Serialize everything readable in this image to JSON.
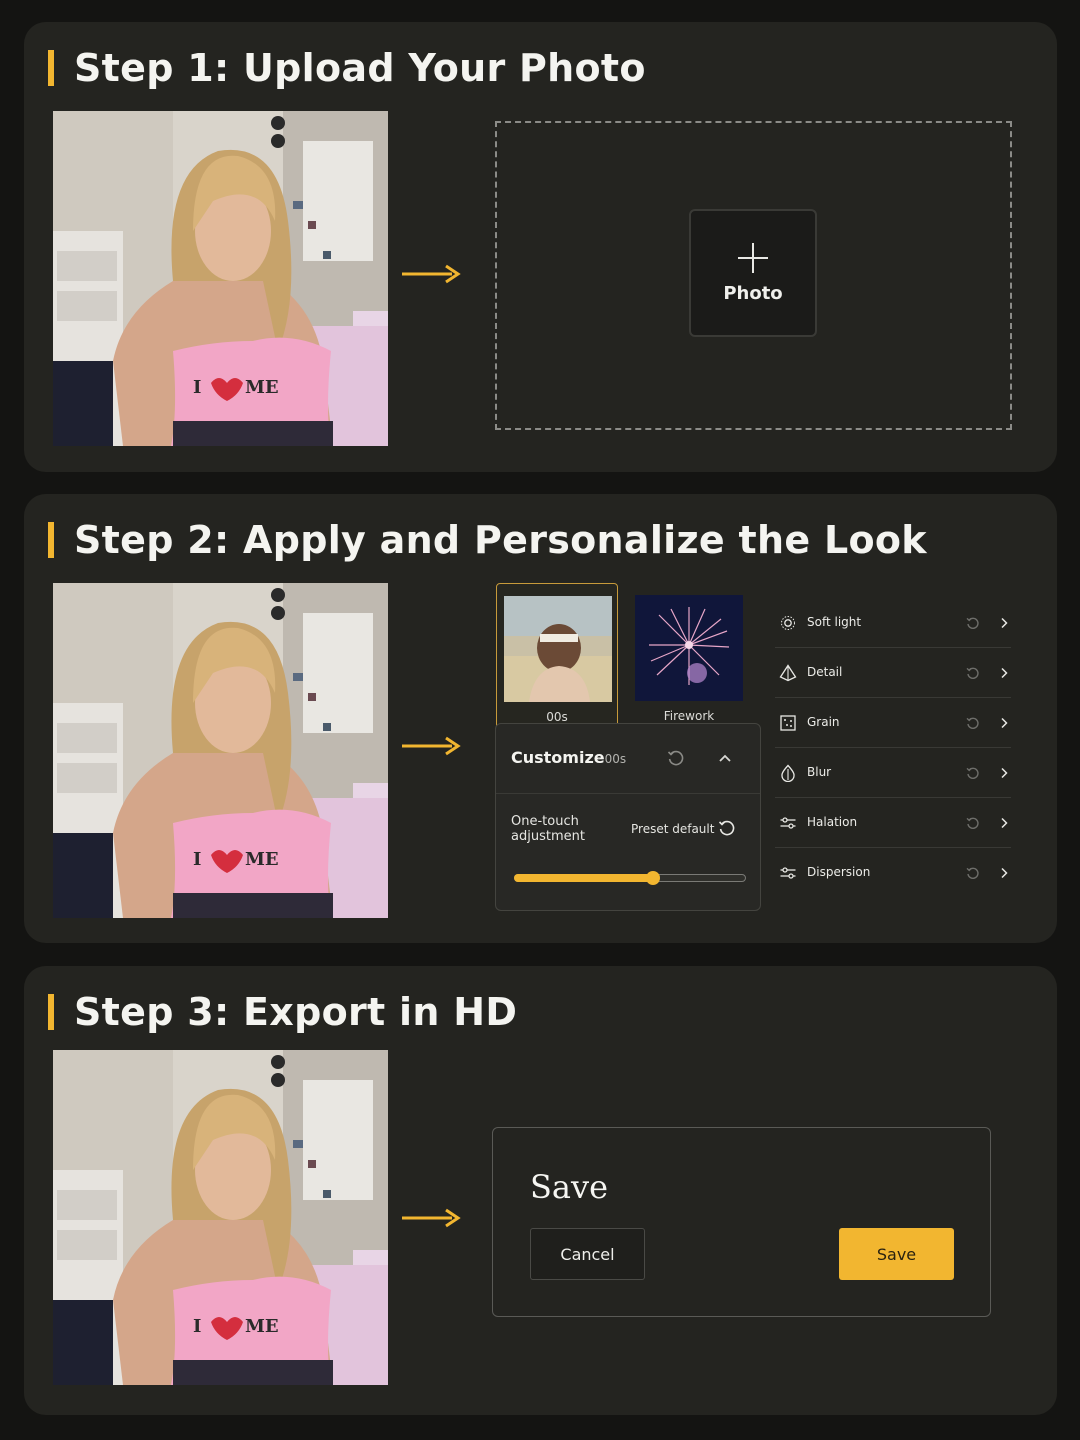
{
  "colors": {
    "accent": "#f2b630",
    "background": "#141412",
    "card": "#242420"
  },
  "step1": {
    "title": "Step 1: Upload Your Photo",
    "upload_button_label": "Photo",
    "upload_icon": "plus-icon"
  },
  "step2": {
    "title": "Step 2: Apply and Personalize the Look",
    "presets": [
      {
        "label": "00s",
        "selected": true
      },
      {
        "label": "Firework",
        "selected": false
      }
    ],
    "customize": {
      "title": "Customize",
      "subtitle": "· 00s",
      "one_touch_label": "One-touch adjustment",
      "preset_default_label": "Preset default",
      "slider_value": 0.6
    },
    "adjustments": [
      {
        "label": "Soft light",
        "icon": "sun-icon"
      },
      {
        "label": "Detail",
        "icon": "pyramid-icon"
      },
      {
        "label": "Grain",
        "icon": "grain-icon"
      },
      {
        "label": "Blur",
        "icon": "drop-icon"
      },
      {
        "label": "Halation",
        "icon": "sliders-icon"
      },
      {
        "label": "Dispersion",
        "icon": "sliders-icon"
      }
    ]
  },
  "step3": {
    "title": "Step 3: Export in HD",
    "dialog_title": "Save",
    "cancel_label": "Cancel",
    "save_label": "Save"
  }
}
